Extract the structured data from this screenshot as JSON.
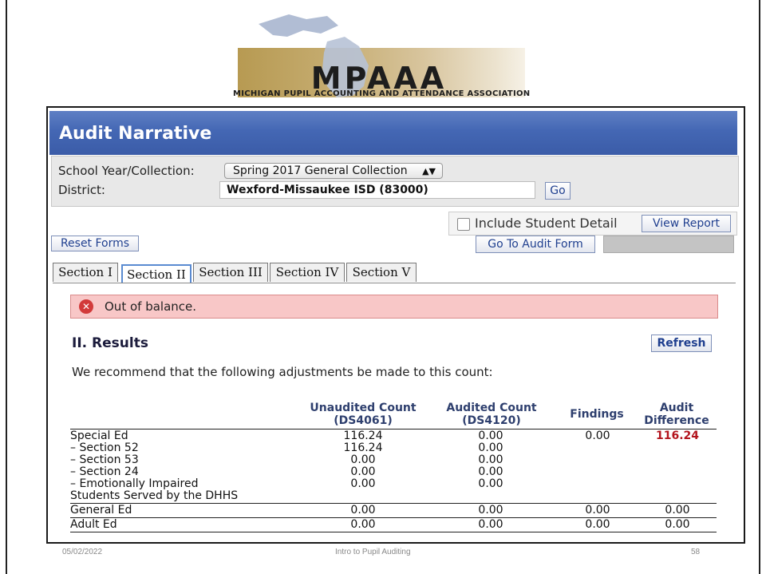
{
  "logo": {
    "name": "MPAAA",
    "subtitle": "MICHIGAN PUPIL ACCOUNTING AND ATTENDANCE ASSOCIATION"
  },
  "page_title": "Audit Narrative",
  "filters": {
    "school_year_label": "School Year/Collection:",
    "school_year_value": "Spring 2017 General Collection",
    "district_label": "District:",
    "district_value": "Wexford-Missaukee ISD (83000)",
    "go_label": "Go"
  },
  "actions": {
    "include_detail_label": "Include Student Detail",
    "include_detail_checked": false,
    "view_report_label": "View Report",
    "reset_forms_label": "Reset Forms",
    "go_to_audit_form_label": "Go To Audit Form"
  },
  "tabs": [
    {
      "label": "Section I",
      "active": false
    },
    {
      "label": "Section II",
      "active": true
    },
    {
      "label": "Section III",
      "active": false
    },
    {
      "label": "Section IV",
      "active": false
    },
    {
      "label": "Section V",
      "active": false
    }
  ],
  "error": {
    "message": "Out of balance.",
    "icon": "error-x-icon",
    "color": "#d23a3a"
  },
  "results": {
    "title": "II. Results",
    "refresh_label": "Refresh",
    "recommendation": "We recommend that the following adjustments be made to this count:",
    "columns": {
      "unaudited_1": "Unaudited Count",
      "unaudited_2": "(DS4061)",
      "audited_1": "Audited Count",
      "audited_2": "(DS4120)",
      "findings": "Findings",
      "difference_1": "Audit",
      "difference_2": "Difference"
    },
    "rows": [
      {
        "label": "Special Ed",
        "unaudited": "116.24",
        "audited": "0.00",
        "findings": "0.00",
        "difference": "116.24"
      },
      {
        "label": "– Section 52",
        "unaudited": "116.24",
        "audited": "0.00",
        "findings": "",
        "difference": ""
      },
      {
        "label": "– Section 53",
        "unaudited": "0.00",
        "audited": "0.00",
        "findings": "",
        "difference": ""
      },
      {
        "label": "– Section 24",
        "unaudited": "0.00",
        "audited": "0.00",
        "findings": "",
        "difference": ""
      },
      {
        "label": "– Emotionally Impaired",
        "unaudited": "0.00",
        "audited": "0.00",
        "findings": "",
        "difference": ""
      },
      {
        "label": "Students Served by the DHHS",
        "unaudited": "",
        "audited": "",
        "findings": "",
        "difference": ""
      },
      {
        "label": "General Ed",
        "unaudited": "0.00",
        "audited": "0.00",
        "findings": "0.00",
        "difference": "0.00"
      },
      {
        "label": "Adult Ed",
        "unaudited": "0.00",
        "audited": "0.00",
        "findings": "0.00",
        "difference": "0.00"
      }
    ],
    "highlight_color": "#b3141d"
  },
  "footer": {
    "date": "05/02/2022",
    "title": "Intro to Pupil Auditing",
    "page": "58"
  }
}
